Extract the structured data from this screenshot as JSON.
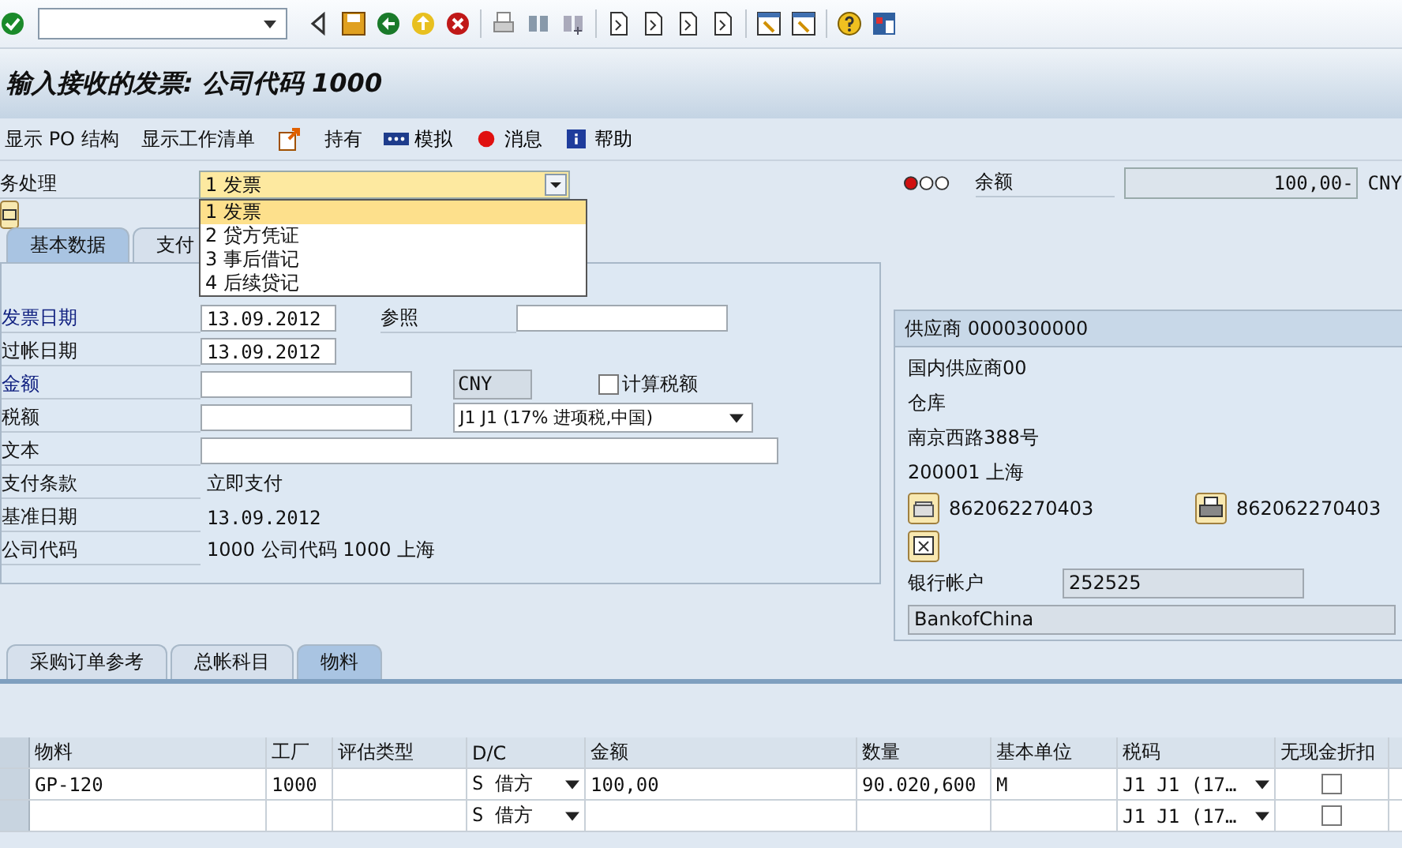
{
  "title": "输入接收的发票: 公司代码 1000",
  "app_toolbar": [
    {
      "kind": "text",
      "label": "显示 PO 结构"
    },
    {
      "kind": "text",
      "label": "显示工作清单"
    },
    {
      "kind": "icon"
    },
    {
      "kind": "text",
      "label": "持有"
    },
    {
      "kind": "simulate",
      "label": "模拟"
    },
    {
      "kind": "message",
      "label": "消息"
    },
    {
      "kind": "help",
      "label": "帮助"
    }
  ],
  "transaction": {
    "label": "务处理",
    "value": "1 发票",
    "expanded": true,
    "options": [
      {
        "label": "1 发票",
        "selected": true
      },
      {
        "label": "2 贷方凭证",
        "selected": false
      },
      {
        "label": "3 事后借记",
        "selected": false
      },
      {
        "label": "4 后续贷记",
        "selected": false
      }
    ]
  },
  "balance": {
    "alert": true,
    "label": "余额",
    "value": "100,00-",
    "currency": "CNY"
  },
  "tabs": [
    {
      "label": "基本数据",
      "selected": true
    },
    {
      "label": "支付",
      "selected": false
    }
  ],
  "basic_data": {
    "invoice_date": {
      "label": "发票日期",
      "required": true,
      "value": "13.09.2012"
    },
    "reference": {
      "label": "参照",
      "required": false
    },
    "posting_date": {
      "label": "过帐日期",
      "required": false,
      "value": "13.09.2012"
    },
    "amount": {
      "label": "金额",
      "required": true,
      "currency": "CNY"
    },
    "calc_tax": {
      "label": "计算税额",
      "checked": false
    },
    "tax_amount": {
      "label": "税额",
      "required": false,
      "tax_code": "J1 J1 (17% 进项税,中国)"
    },
    "text": {
      "label": "文本",
      "required": false
    },
    "payment_terms": {
      "label": "支付条款",
      "value": "立即支付"
    },
    "baseline_date": {
      "label": "基准日期",
      "value": "13.09.2012"
    },
    "company_code": {
      "label": "公司代码",
      "value": "1000 公司代码 1000 上海"
    }
  },
  "vendor": {
    "header": "供应商 0000300000",
    "name": "国内供应商00",
    "line_2": "仓库",
    "street": "南京西路388号",
    "city": "200001 上海",
    "phone": "862062270403",
    "fax": "862062270403",
    "bank_account_label": "银行帐户",
    "bank_account": "252525",
    "bank_name": "BankofChina"
  },
  "lower_tabs": [
    {
      "label": "采购订单参考",
      "selected": false
    },
    {
      "label": "总帐科目",
      "selected": false
    },
    {
      "label": "物料",
      "selected": true
    }
  ],
  "table": {
    "columns": [
      {
        "label": "物料"
      },
      {
        "label": "工厂"
      },
      {
        "label": "评估类型"
      },
      {
        "label": "D/C"
      },
      {
        "label": "金额"
      },
      {
        "label": "数量"
      },
      {
        "label": "基本单位"
      },
      {
        "label": "税码"
      },
      {
        "label": "无现金折扣"
      }
    ],
    "rows": [
      {
        "material": "GP-120",
        "plant": "1000",
        "dc": "S 借方",
        "amount": "100,00",
        "quantity": "90.020,600",
        "unit": "M",
        "tax_code": "J1 J1 (17…",
        "no_discount": false
      },
      {
        "dc": "S 借方",
        "tax_code": "J1 J1 (17…",
        "no_discount": false
      }
    ]
  }
}
